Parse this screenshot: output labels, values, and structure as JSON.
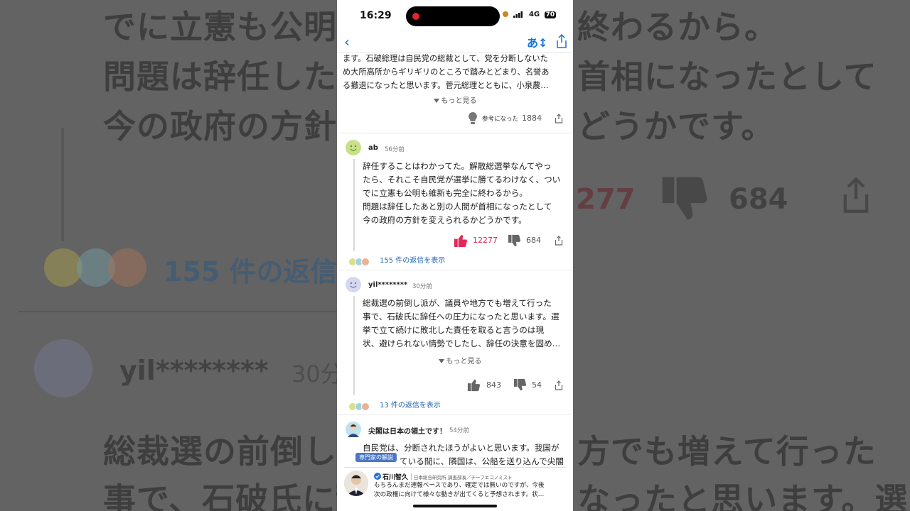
{
  "background": {
    "lines": [
      "でに立憲も公明",
      "問題は辞任した",
      "今の政府の方針"
    ],
    "right_lines": [
      "終わるから。",
      "首相になったとして",
      "どうかです。"
    ],
    "likes": "277",
    "dislikes": "684",
    "replies": "155 件の返信を",
    "user": "yil********",
    "time": "30分",
    "lower_lines": [
      "総裁選の前倒し",
      "事で、石破氏に辞"
    ],
    "lower_right": [
      "方でも増えて行った",
      "なったと思います。選"
    ]
  },
  "statusbar": {
    "time": "16:29",
    "network": "4G",
    "battery": "70"
  },
  "navbar": {
    "back": "‹",
    "translate": "あ↕"
  },
  "top_comment": {
    "text_lines": [
      "ます。石破総理は自民党の総裁として、党を分断しないた",
      "め大所高所からギリギリのところで踏みとどまり、名誉あ",
      "る撤退になったと思います。菅元総理とともに、小泉農…"
    ],
    "more": "もっと見る",
    "helpful_label": "参考になった",
    "helpful_count": "1884"
  },
  "comments": [
    {
      "user": "ab",
      "time": "56分前",
      "lines": [
        "辞任することはわかってた。解散総選挙なんてやっ",
        "たら、それこそ自民党が選挙に勝てるわけなく、つい",
        "でに立憲も公明も維新も完全に終わるから。",
        "問題は辞任したあと別の人間が首相になったとして",
        "今の政府の方針を変えられるかどうかです。"
      ],
      "likes": "12277",
      "dislikes": "684",
      "replies": "155 件の返信を表示"
    },
    {
      "user": "yil********",
      "time": "30分前",
      "lines": [
        "総裁選の前倒し派が、議員や地方でも増えて行った",
        "事で、石破氏に辞任への圧力になったと思います。選",
        "挙で立て続けに敗北した責任を取ると言うのは現",
        "状、避けられない情勢でしたし、辞任の決意を固め…"
      ],
      "more": "もっと見る",
      "likes": "843",
      "dislikes": "54",
      "replies": "13 件の返信を表示"
    },
    {
      "user": "尖閣は日本の領土です！",
      "time": "54分前",
      "lines": [
        "自民党は、分断されたほうがよいと思います。我国が",
        "ている間に、隣国は、公船を送り込んで尖閣"
      ]
    }
  ],
  "expert": {
    "badge": "専門家の解説",
    "name": "石川智久",
    "org": "日本総合研究所",
    "title": "調査部長／チーフエコノミスト",
    "lines": [
      "もちろんまだ速報ベースであり、確定では無いのですが、今後",
      "次の政権に向けて様々な動きが出てくると予想されます。状…"
    ]
  }
}
